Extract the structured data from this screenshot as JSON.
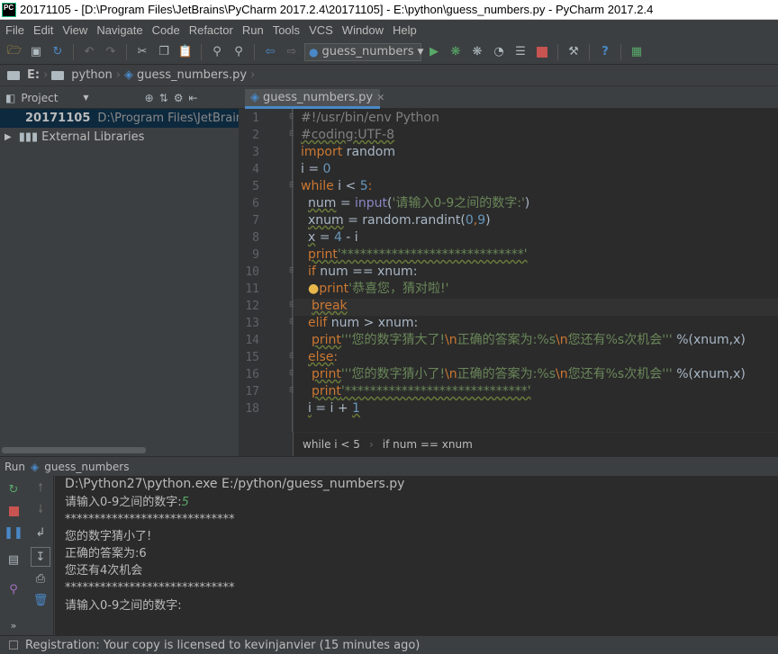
{
  "window": {
    "title": "20171105 - [D:\\Program Files\\JetBrains\\PyCharm 2017.2.4\\20171105] - E:\\python\\guess_numbers.py - PyCharm 2017.2.4",
    "logo": "PC"
  },
  "menu": [
    "File",
    "Edit",
    "View",
    "Navigate",
    "Code",
    "Refactor",
    "Run",
    "Tools",
    "VCS",
    "Window",
    "Help"
  ],
  "toolbar": {
    "run_config": "guess_numbers"
  },
  "navbar": {
    "drive": "E:",
    "folder": "python",
    "file": "guess_numbers.py"
  },
  "project_panel": {
    "title": "Project",
    "root_name": "20171105",
    "root_path": "D:\\Program Files\\JetBrains\\",
    "external": "External Libraries"
  },
  "editor": {
    "tab": "guess_numbers.py",
    "line_numbers": [
      "1",
      "2",
      "3",
      "4",
      "5",
      "6",
      "7",
      "8",
      "9",
      "10",
      "11",
      "12",
      "13",
      "14",
      "15",
      "16",
      "17",
      "18"
    ],
    "code": {
      "l1": "#!/usr/bin/env Python",
      "l2": "#coding:UTF-8",
      "l3a": "import",
      "l3b": " random",
      "l4a": "i = ",
      "l4b": "0",
      "l5a": "while",
      "l5b": " i < ",
      "l5c": "5",
      "l5d": ":",
      "l6a": "num",
      "l6b": " = ",
      "l6c": "input",
      "l6d": "(",
      "l6e": "'请输入0-9之间的数字:'",
      "l6f": ")",
      "l7a": "xnum",
      "l7b": " = random.randint(",
      "l7c": "0",
      "l7d": ",",
      "l7e": "9",
      "l7f": ")",
      "l8a": "x",
      "l8b": " = ",
      "l8c": "4",
      "l8d": " - i",
      "l9a": "print",
      "l9b": "'*****************************'",
      "l10a": "if",
      "l10b": " num == xnum:",
      "l11a": "print",
      "l11b": "'恭喜您，猜对啦!'",
      "l12a": "break",
      "l13a": "elif",
      "l13b": " num > xnum:",
      "l14a": "print",
      "l14b": "'''您的数字猜大了!",
      "l14c": "\\n",
      "l14d": "正确的答案为:%s",
      "l14e": "\\n",
      "l14f": "您还有%s次机会'''",
      "l14g": " %(xnum,x)",
      "l15a": "else",
      "l15b": ":",
      "l16a": "print",
      "l16b": "'''您的数字猜小了!",
      "l16c": "\\n",
      "l16d": "正确的答案为:%s",
      "l16e": "\\n",
      "l16f": "您还有%s次机会'''",
      "l16g": " %(xnum,x)",
      "l17a": "print",
      "l17b": "'*****************************'",
      "l18a": "i",
      "l18b": " = i + ",
      "l18c": "1"
    },
    "breadcrumb": [
      "while i < 5",
      "if num == xnum"
    ]
  },
  "run": {
    "label": "Run",
    "config": "guess_numbers",
    "lines": [
      "D:\\Python27\\python.exe E:/python/guess_numbers.py",
      "请输入0-9之间的数字:",
      "*****************************",
      "您的数字猜小了!",
      "正确的答案为:6",
      "您还有4次机会",
      "*****************************",
      "请输入0-9之间的数字:"
    ],
    "user_input": "5"
  },
  "status": "Registration: Your copy is licensed to kevinjanvier (15 minutes ago)",
  "colors": {
    "keyword": "#cc7832",
    "string": "#6a8759",
    "number": "#6897bb",
    "comment": "#808080",
    "builtin": "#8888c6",
    "run_green": "#59a869",
    "stop_red": "#c75450"
  }
}
